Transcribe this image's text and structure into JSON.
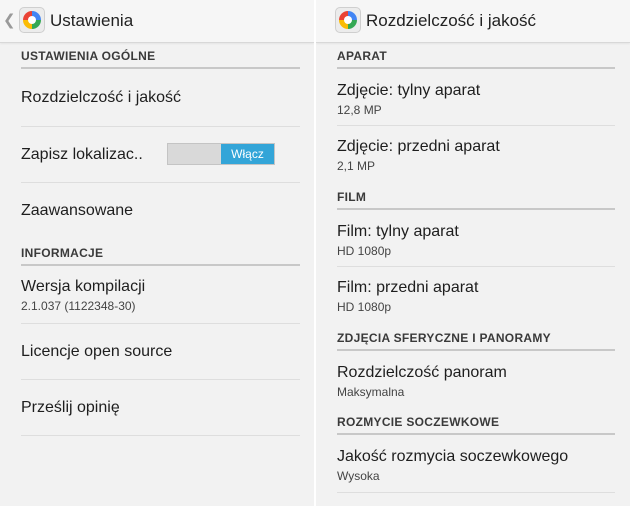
{
  "left": {
    "title": "Ustawienia",
    "sections": {
      "general": "USTAWIENIA OGÓLNE",
      "info": "INFORMACJE"
    },
    "items": {
      "resolution": "Rozdzielczość i jakość",
      "location": "Zapisz lokalizac..",
      "location_toggle": "Włącz",
      "advanced": "Zaawansowane",
      "build_version": "Wersja kompilacji",
      "build_version_value": "2.1.037 (1122348-30)",
      "licenses": "Licencje open source",
      "feedback": "Prześlij opinię"
    }
  },
  "right": {
    "title": "Rozdzielczość i jakość",
    "sections": {
      "camera": "APARAT",
      "video": "FILM",
      "panorama": "ZDJĘCIA SFERYCZNE I PANORAMY",
      "lens_blur": "ROZMYCIE SOCZEWKOWE"
    },
    "items": [
      {
        "label": "Zdjęcie: tylny aparat",
        "value": "12,8 MP"
      },
      {
        "label": "Zdjęcie: przedni aparat",
        "value": "2,1 MP"
      },
      {
        "label": "Film: tylny aparat",
        "value": "HD 1080p"
      },
      {
        "label": "Film: przedni aparat",
        "value": "HD 1080p"
      },
      {
        "label": "Rozdzielczość panoram",
        "value": "Maksymalna"
      },
      {
        "label": "Jakość rozmycia soczewkowego",
        "value": "Wysoka"
      }
    ]
  }
}
